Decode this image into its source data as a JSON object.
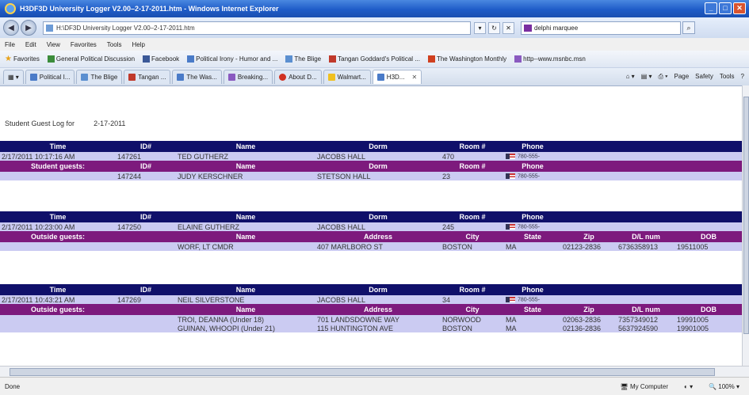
{
  "window": {
    "title": "H3DF3D University Logger V2.00–2-17-2011.htm - Windows Internet Explorer"
  },
  "address_bar": {
    "url": "H:\\DF3D University Logger V2.00–2-17-2011.htm",
    "search_value": "delphi marquee"
  },
  "menu": [
    "File",
    "Edit",
    "View",
    "Favorites",
    "Tools",
    "Help"
  ],
  "favorites": {
    "label": "Favorites",
    "items": [
      "General Political Discussion",
      "Facebook",
      "Political Irony - Humor and ...",
      "The Blige",
      "Tangan Goddard's Political ...",
      "The Washington Monthly",
      "http--www.msnbc.msn"
    ]
  },
  "tabs": [
    {
      "label": "Political I..."
    },
    {
      "label": "The Blige"
    },
    {
      "label": "Tangan ..."
    },
    {
      "label": "The Was..."
    },
    {
      "label": "Breaking..."
    },
    {
      "label": "About D..."
    },
    {
      "label": "Walmart..."
    },
    {
      "label": "H3D..."
    }
  ],
  "command_bar": [
    "Page",
    "Safety",
    "Tools"
  ],
  "page": {
    "heading_label": "Student Guest Log for",
    "heading_date": "2-17-2011",
    "main_headers": {
      "time": "Time",
      "id": "ID#",
      "name": "Name",
      "dorm": "Dorm",
      "room": "Room #",
      "phone": "Phone"
    },
    "student_guest_headers": {
      "label": "Student guests:",
      "id": "ID#",
      "name": "Name",
      "dorm": "Dorm",
      "room": "Room #",
      "phone": "Phone"
    },
    "outside_guest_headers": {
      "label": "Outside guests:",
      "name": "Name",
      "address": "Address",
      "city": "City",
      "state": "State",
      "zip": "Zip",
      "dl": "D/L num",
      "dob": "DOB"
    },
    "phone_text": "780-555-",
    "entries": [
      {
        "time": "2/17/2011 10:17:16 AM",
        "id": "147261",
        "name": "TED GUTHERZ",
        "dorm": "JACOBS HALL",
        "room": "470",
        "student_guests": [
          {
            "id": "147244",
            "name": "JUDY KERSCHNER",
            "dorm": "STETSON HALL",
            "room": "23"
          }
        ]
      },
      {
        "time": "2/17/2011 10:23:00 AM",
        "id": "147250",
        "name": "ELAINE GUTHERZ",
        "dorm": "JACOBS HALL",
        "room": "245",
        "outside_guests": [
          {
            "name": "WORF, LT CMDR",
            "address": "407 MARLBORO ST",
            "city": "BOSTON",
            "state": "MA",
            "zip": "02123-2836",
            "dl": "6736358913",
            "dob": "19511005"
          }
        ]
      },
      {
        "time": "2/17/2011 10:43:21 AM",
        "id": "147269",
        "name": "NEIL SILVERSTONE",
        "dorm": "JACOBS HALL",
        "room": "34",
        "outside_guests": [
          {
            "name": "TROI, DEANNA (Under 18)",
            "address": "701 LANDSDOWNE WAY",
            "city": "NORWOOD",
            "state": "MA",
            "zip": "02063-2836",
            "dl": "7357349012",
            "dob": "19991005"
          },
          {
            "name": "GUINAN, WHOOPI (Under 21)",
            "address": "115 HUNTINGTON AVE",
            "city": "BOSTON",
            "state": "MA",
            "zip": "02136-2836",
            "dl": "5637924590",
            "dob": "19901005"
          }
        ]
      }
    ]
  },
  "status": {
    "left": "Done",
    "zone": "My Computer",
    "zoom": "100%"
  }
}
